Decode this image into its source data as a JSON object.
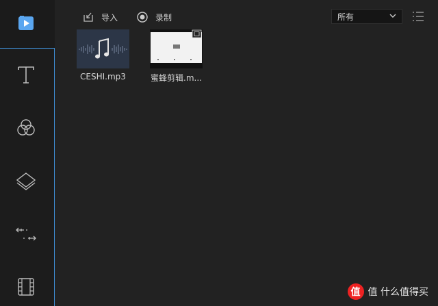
{
  "toolbar": {
    "import_label": "导入",
    "record_label": "录制",
    "filter_value": "所有"
  },
  "sidebar": {
    "items": [
      {
        "icon": "media-icon"
      },
      {
        "icon": "text-icon"
      },
      {
        "icon": "filters-icon"
      },
      {
        "icon": "overlays-icon"
      },
      {
        "icon": "transitions-icon"
      },
      {
        "icon": "elements-icon"
      }
    ]
  },
  "media": {
    "items": [
      {
        "name": "CESHI.mp3",
        "type": "audio"
      },
      {
        "name": "蜜蜂剪辑.m...",
        "type": "video"
      }
    ]
  },
  "watermark": {
    "text": "值 什么值得买"
  },
  "colors": {
    "accent": "#3f8fd6",
    "active_icon": "#5aa6f0",
    "background": "#222222"
  }
}
